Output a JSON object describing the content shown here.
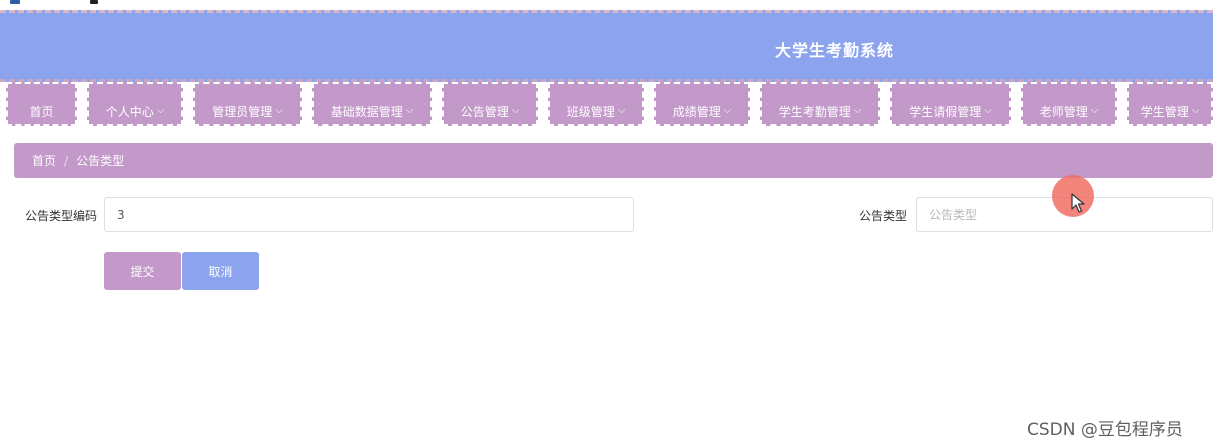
{
  "header": {
    "title": "大学生考勤系统"
  },
  "nav": {
    "items": [
      {
        "label": "首页",
        "has_dropdown": false
      },
      {
        "label": "个人中心",
        "has_dropdown": true
      },
      {
        "label": "管理员管理",
        "has_dropdown": true
      },
      {
        "label": "基础数据管理",
        "has_dropdown": true
      },
      {
        "label": "公告管理",
        "has_dropdown": true
      },
      {
        "label": "班级管理",
        "has_dropdown": true
      },
      {
        "label": "成绩管理",
        "has_dropdown": true
      },
      {
        "label": "学生考勤管理",
        "has_dropdown": true
      },
      {
        "label": "学生请假管理",
        "has_dropdown": true
      },
      {
        "label": "老师管理",
        "has_dropdown": true
      },
      {
        "label": "学生管理",
        "has_dropdown": true
      }
    ],
    "dropdown_icon": "chevron-down-icon"
  },
  "breadcrumb": {
    "home": "首页",
    "separator": "/",
    "current": "公告类型"
  },
  "form": {
    "code_label": "公告类型编码",
    "code_value": "3",
    "type_label": "公告类型",
    "type_value": "",
    "type_placeholder": "公告类型",
    "submit_label": "提交",
    "cancel_label": "取消"
  },
  "watermark": "CSDN @豆包程序员",
  "colors": {
    "header": "#8ca3ee",
    "nav": "#c299c8",
    "submit": "#c299c8",
    "cancel": "#8ca3ee"
  }
}
